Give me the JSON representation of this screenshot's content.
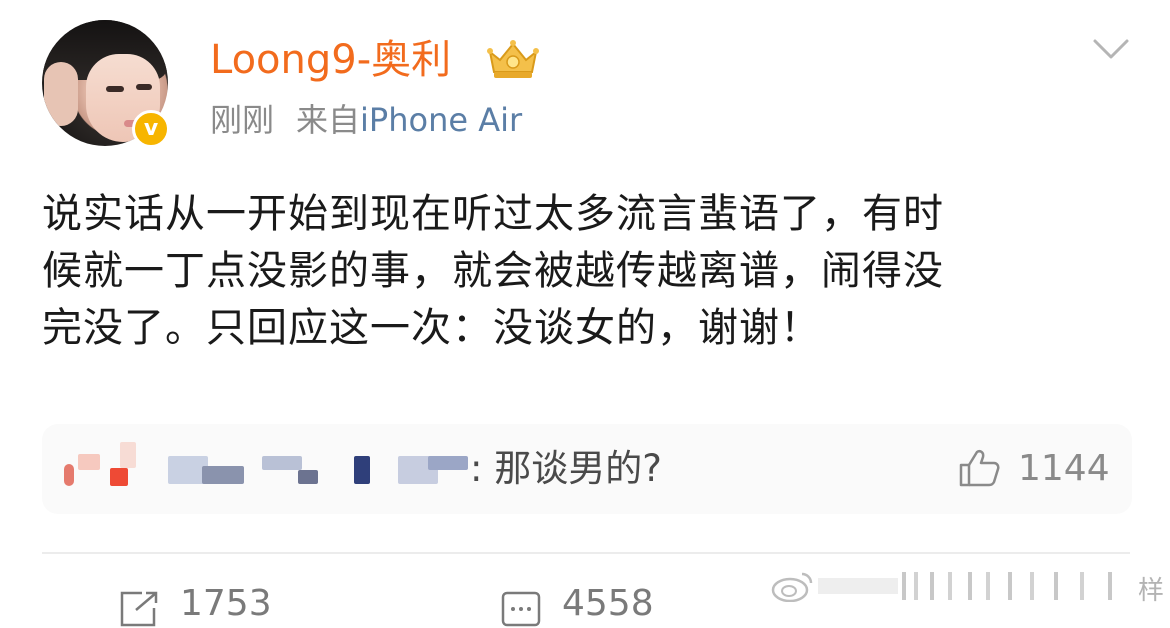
{
  "post": {
    "author_name": "Loong9-奥利",
    "time": "刚刚",
    "source_prefix": "来自",
    "source_device": "iPhone Air",
    "body_lines": [
      "说实话从一开始到现在听过太多流言蜚语了，有时",
      "候就一丁点没影的事，就会被越传越离谱，闹得没",
      "完没了。只回应这一次：没谈女的，谢谢！"
    ]
  },
  "hot_comment": {
    "text": ": 那谈男的?",
    "likes": "1144"
  },
  "actions": {
    "reposts": "1753",
    "comments": "4558"
  },
  "watermark": {
    "text": "样"
  },
  "icons": {
    "verified": "v-badge-icon",
    "crown": "crown-icon",
    "menu": "chevron-down-icon",
    "like": "thumbs-up-icon",
    "repost": "repost-icon",
    "comment": "comment-icon",
    "watermark": "weibo-logo-icon"
  },
  "colors": {
    "author": "#f26b1d",
    "device": "#5b7ea6",
    "meta": "#8a8a8a",
    "body": "#1a1a1a",
    "verified": "#f7b500"
  }
}
